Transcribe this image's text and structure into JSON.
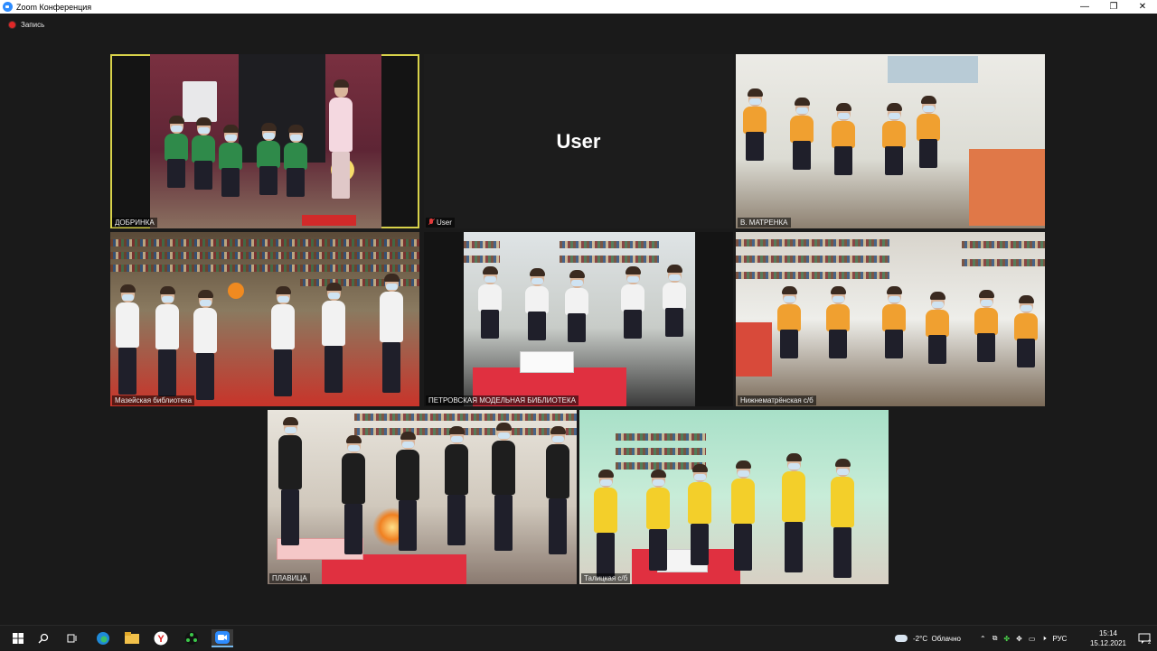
{
  "window": {
    "title": "Zoom Конференция",
    "controls": [
      "—",
      "❐",
      "✕"
    ]
  },
  "recording": {
    "label": "Запись"
  },
  "tiles": [
    {
      "name": "ДОБРИНКА",
      "muted": false,
      "active": true,
      "has_video": true
    },
    {
      "name": "User",
      "muted": true,
      "active": false,
      "has_video": false,
      "center_name": "User"
    },
    {
      "name": "В. МАТРЕНКА",
      "muted": false,
      "active": false,
      "has_video": true
    },
    {
      "name": "Мазейская библиотека",
      "muted": false,
      "active": false,
      "has_video": true
    },
    {
      "name": "ПЕТРОВСКАЯ МОДЕЛЬНАЯ БИБЛИОТЕКА",
      "muted": false,
      "active": false,
      "has_video": true
    },
    {
      "name": "Нижнематрёнская с/б",
      "muted": false,
      "active": false,
      "has_video": true
    },
    {
      "name": "ПЛАВИЦА",
      "muted": false,
      "active": false,
      "has_video": true
    },
    {
      "name": "Талицкая с/б",
      "muted": false,
      "active": false,
      "has_video": true
    }
  ],
  "taskbar": {
    "apps": [
      "windows-start",
      "search",
      "task-view",
      "edge",
      "file-explorer",
      "yandex",
      "app-green",
      "zoom"
    ],
    "weather": "-2°C  Облачно",
    "language": "РУС",
    "time": "15:14",
    "date": "15.12.2021"
  },
  "colors": {
    "active_outline": "#d8d24a",
    "orange_shirt": "#f0a030",
    "green_shirt": "#2f8a4a",
    "white_shirt": "#f2f2f2",
    "black_shirt": "#1e1e1e",
    "yellow_shirt": "#f3cf2a"
  }
}
